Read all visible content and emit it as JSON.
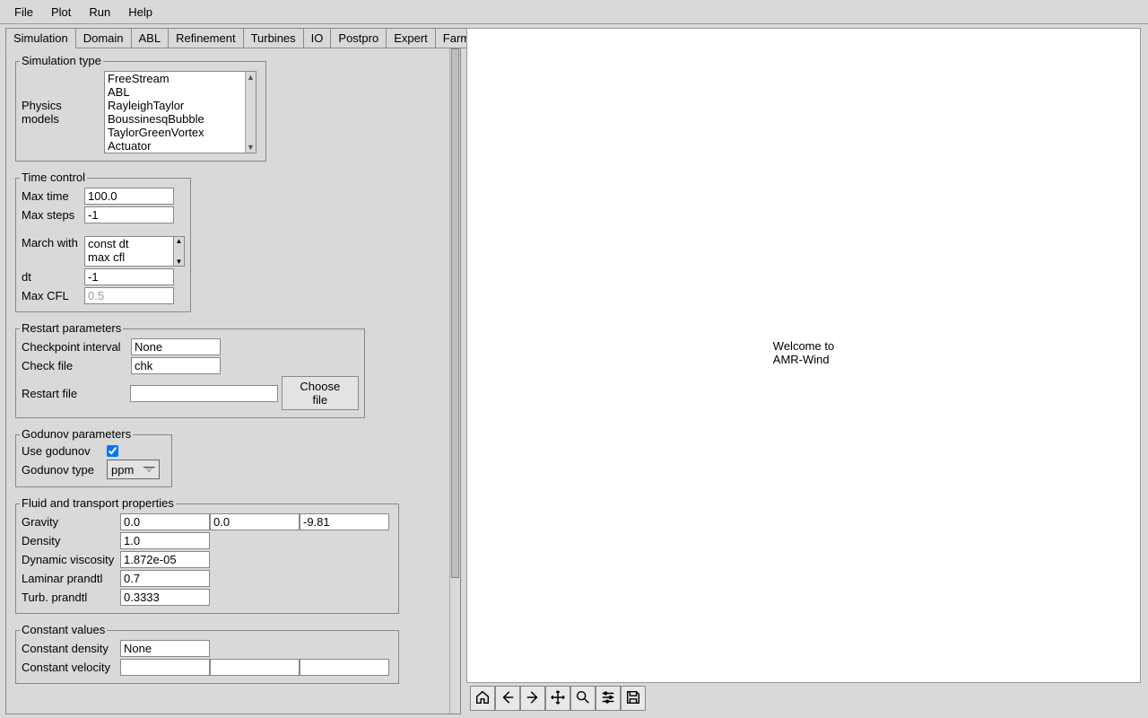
{
  "menu": {
    "file": "File",
    "plot": "Plot",
    "run": "Run",
    "help": "Help"
  },
  "tabs": [
    "Simulation",
    "Domain",
    "ABL",
    "Refinement",
    "Turbines",
    "IO",
    "Postpro",
    "Expert",
    "Farm"
  ],
  "simtype": {
    "legend": "Simulation type",
    "models_label": "Physics models",
    "models": [
      "FreeStream",
      "ABL",
      "RayleighTaylor",
      "BoussinesqBubble",
      "TaylorGreenVortex",
      "Actuator"
    ]
  },
  "timectl": {
    "legend": "Time control",
    "max_time_label": "Max time",
    "max_time": "100.0",
    "max_steps_label": "Max steps",
    "max_steps": "-1",
    "march_label": "March with",
    "march_opts": [
      "const dt",
      "max cfl"
    ],
    "march_sel": "const dt",
    "dt_label": "dt",
    "dt": "-1",
    "maxcfl_label": "Max CFL",
    "maxcfl": "0.5"
  },
  "restart": {
    "legend": "Restart parameters",
    "chk_int_label": "Checkpoint interval",
    "chk_int": "None",
    "chk_file_label": "Check file",
    "chk_file": "chk",
    "restart_file_label": "Restart file",
    "restart_file": "",
    "choose_btn": "Choose file"
  },
  "godunov": {
    "legend": "Godunov parameters",
    "use_label": "Use godunov",
    "use_checked": true,
    "type_label": "Godunov type",
    "type_value": "ppm"
  },
  "fluid": {
    "legend": "Fluid and transport properties",
    "gravity_label": "Gravity",
    "g0": "0.0",
    "g1": "0.0",
    "g2": "-9.81",
    "density_label": "Density",
    "density": "1.0",
    "visc_label": "Dynamic viscosity",
    "visc": "1.872e-05",
    "lam_label": "Laminar prandtl",
    "lam": "0.7",
    "turb_label": "Turb. prandtl",
    "turb": "0.3333"
  },
  "constvals": {
    "legend": "Constant values",
    "den_label": "Constant density",
    "den": "None",
    "vel_label": "Constant velocity",
    "v0": "",
    "v1": "",
    "v2": ""
  },
  "welcome": {
    "line1": "Welcome to",
    "line2": "AMR-Wind"
  },
  "toolbar": {
    "home": "home",
    "back": "back",
    "fwd": "forward",
    "pan": "pan",
    "zoom": "zoom",
    "cfg": "configure",
    "save": "save"
  }
}
